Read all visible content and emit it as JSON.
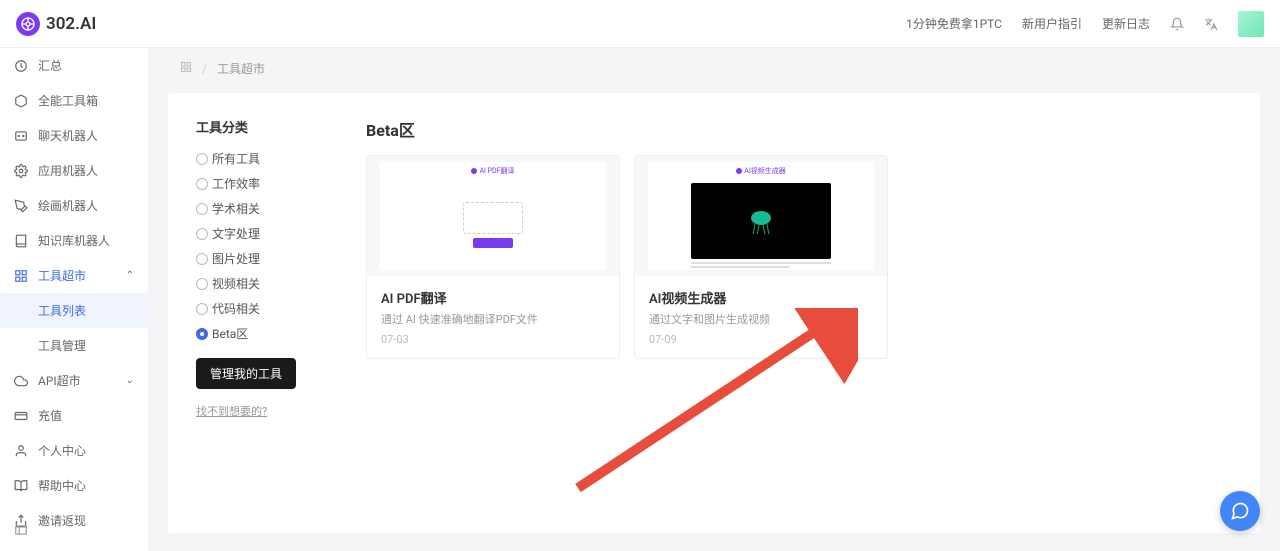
{
  "header": {
    "logo_text": "302.AI",
    "links": [
      "1分钟免费拿1PTC",
      "新用户指引",
      "更新日志"
    ]
  },
  "sidebar": {
    "items": [
      {
        "icon": "dashboard",
        "label": "汇总"
      },
      {
        "icon": "cube-outline",
        "label": "全能工具箱"
      },
      {
        "icon": "chat",
        "label": "聊天机器人"
      },
      {
        "icon": "app",
        "label": "应用机器人"
      },
      {
        "icon": "paint",
        "label": "绘画机器人"
      },
      {
        "icon": "book",
        "label": "知识库机器人"
      },
      {
        "icon": "grid",
        "label": "工具超市",
        "expanded": true,
        "active": true,
        "children": [
          {
            "label": "工具列表",
            "active": true
          },
          {
            "label": "工具管理"
          }
        ]
      },
      {
        "icon": "cloud",
        "label": "API超市",
        "expandable": true
      },
      {
        "icon": "wallet",
        "label": "充值"
      },
      {
        "icon": "user",
        "label": "个人中心"
      },
      {
        "icon": "help",
        "label": "帮助中心"
      },
      {
        "icon": "share",
        "label": "邀请返现"
      }
    ]
  },
  "breadcrumb": {
    "current": "工具超市"
  },
  "categories": {
    "title": "工具分类",
    "options": [
      "所有工具",
      "工作效率",
      "学术相关",
      "文字处理",
      "图片处理",
      "视频相关",
      "代码相关",
      "Beta区"
    ],
    "selected": "Beta区",
    "manage_btn": "管理我的工具",
    "not_found": "找不到想要的?"
  },
  "tools": {
    "section_title": "Beta区",
    "items": [
      {
        "name": "AI PDF翻译",
        "desc": "通过 AI 快速准确地翻译PDF文件",
        "date": "07-03",
        "preview_label": "AI PDF翻译"
      },
      {
        "name": "AI视频生成器",
        "desc": "通过文字和图片生成视频",
        "date": "07-09",
        "preview_label": "AI视频生成器"
      }
    ]
  }
}
